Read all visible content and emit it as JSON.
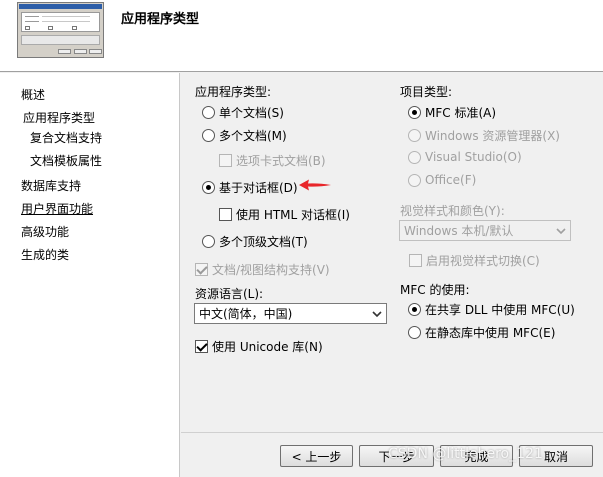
{
  "header": {
    "title": "应用程序类型"
  },
  "sidebar": {
    "items": [
      {
        "label": "概述"
      },
      {
        "label": "应用程序类型"
      },
      {
        "label": "复合文档支持"
      },
      {
        "label": "文档模板属性"
      },
      {
        "label": "数据库支持"
      },
      {
        "label": "用户界面功能"
      },
      {
        "label": "高级功能"
      },
      {
        "label": "生成的类"
      }
    ]
  },
  "app_type": {
    "label": "应用程序类型:",
    "options": [
      {
        "label": "单个文档(S)",
        "checked": false
      },
      {
        "label": "多个文档(M)",
        "checked": false
      },
      {
        "label": "选项卡式文档(B)",
        "checked": false,
        "disabled": true
      },
      {
        "label": "基于对话框(D)",
        "checked": true
      },
      {
        "label": "使用 HTML 对话框(I)",
        "checked": false
      },
      {
        "label": "多个顶级文档(T)",
        "checked": false
      },
      {
        "label": "文档/视图结构支持(V)",
        "checked": true,
        "disabled": true
      }
    ]
  },
  "resource_lang": {
    "label": "资源语言(L):",
    "value": "中文(简体，中国)"
  },
  "unicode": {
    "label": "使用 Unicode 库(N)",
    "checked": true
  },
  "project_type": {
    "label": "项目类型:",
    "options": [
      {
        "label": "MFC 标准(A)",
        "checked": true
      },
      {
        "label": "Windows 资源管理器(X)",
        "disabled": true
      },
      {
        "label": "Visual Studio(O)",
        "disabled": true
      },
      {
        "label": "Office(F)",
        "disabled": true
      }
    ]
  },
  "visual_style": {
    "label": "视觉样式和颜色(Y):",
    "value": "Windows 本机/默认",
    "toggle_label": "启用视觉样式切换(C)"
  },
  "mfc_use": {
    "label": "MFC 的使用:",
    "options": [
      {
        "label": "在共享 DLL 中使用 MFC(U)",
        "checked": true
      },
      {
        "label": "在静态库中使用 MFC(E)",
        "checked": false
      }
    ]
  },
  "buttons": {
    "prev": "< 上一步",
    "next": "下一步",
    "finish": "完成",
    "cancel": "取消"
  },
  "watermark": "CSDN @littlehero_121",
  "colors": {
    "accent_arrow": "#e8262a",
    "thumb_title": "#2d5ea8"
  }
}
